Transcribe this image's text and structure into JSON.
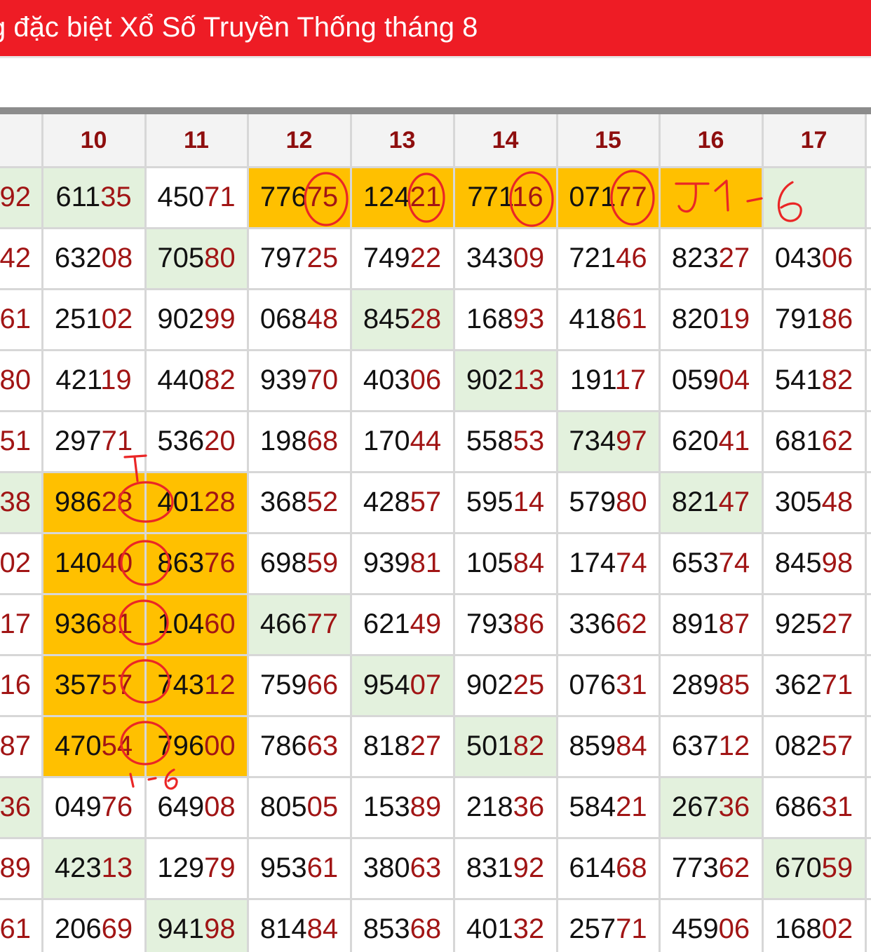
{
  "header": {
    "title": "g đặc biệt Xổ Số Truyền Thống tháng 8"
  },
  "colors": {
    "title_bg": "#ee1c25",
    "orange": "#ffc000",
    "green": "#e3f1dd",
    "tail_digits": "#a11515",
    "header_text": "#8e0e0e",
    "annotation": "#ea2626"
  },
  "table": {
    "columns": [
      "",
      "10",
      "11",
      "12",
      "13",
      "14",
      "15",
      "16",
      "17"
    ],
    "rows": [
      [
        "92",
        "61135",
        "45071",
        "77675",
        "12421",
        "77116",
        "07177",
        "",
        ""
      ],
      [
        "42",
        "63208",
        "70580",
        "79725",
        "74922",
        "34309",
        "72146",
        "82327",
        "04306"
      ],
      [
        "61",
        "25102",
        "90299",
        "06848",
        "84528",
        "16893",
        "41861",
        "82019",
        "79186"
      ],
      [
        "80",
        "42119",
        "44082",
        "93970",
        "40306",
        "90213",
        "19117",
        "05904",
        "54182"
      ],
      [
        "51",
        "29771",
        "53620",
        "19868",
        "17044",
        "55853",
        "73497",
        "62041",
        "68162"
      ],
      [
        "38",
        "98628",
        "40128",
        "36852",
        "42857",
        "59514",
        "57980",
        "82147",
        "30548"
      ],
      [
        "02",
        "14040",
        "86376",
        "69859",
        "93981",
        "10584",
        "17474",
        "65374",
        "84598"
      ],
      [
        "17",
        "93681",
        "10460",
        "46677",
        "62149",
        "79386",
        "33662",
        "89187",
        "92527"
      ],
      [
        "16",
        "35757",
        "74312",
        "75966",
        "95407",
        "90225",
        "07631",
        "28985",
        "36271"
      ],
      [
        "87",
        "47054",
        "79600",
        "78663",
        "81827",
        "50182",
        "85984",
        "63712",
        "08257"
      ],
      [
        "36",
        "04976",
        "64908",
        "80505",
        "15389",
        "21836",
        "58421",
        "26736",
        "68631"
      ],
      [
        "89",
        "42313",
        "12979",
        "95361",
        "38063",
        "83192",
        "61468",
        "77362",
        "67059"
      ],
      [
        "61",
        "20669",
        "94198",
        "81484",
        "85368",
        "40132",
        "25771",
        "45906",
        "16802"
      ]
    ],
    "highlights": [
      [
        "green",
        "green",
        "",
        "orange",
        "orange",
        "orange",
        "orange",
        "orange",
        "green"
      ],
      [
        "",
        "",
        "green",
        "",
        "",
        "",
        "",
        "",
        ""
      ],
      [
        "",
        "",
        "",
        "",
        "green",
        "",
        "",
        "",
        ""
      ],
      [
        "",
        "",
        "",
        "",
        "",
        "green",
        "",
        "",
        ""
      ],
      [
        "",
        "",
        "",
        "",
        "",
        "",
        "green",
        "",
        ""
      ],
      [
        "green",
        "orange",
        "orange",
        "",
        "",
        "",
        "",
        "green",
        ""
      ],
      [
        "",
        "orange",
        "orange",
        "",
        "",
        "",
        "",
        "",
        ""
      ],
      [
        "",
        "orange",
        "orange",
        "green",
        "",
        "",
        "",
        "",
        ""
      ],
      [
        "",
        "orange",
        "orange",
        "",
        "green",
        "",
        "",
        "",
        ""
      ],
      [
        "",
        "orange",
        "orange",
        "",
        "",
        "green",
        "",
        "",
        ""
      ],
      [
        "green",
        "",
        "",
        "",
        "",
        "",
        "",
        "green",
        ""
      ],
      [
        "",
        "green",
        "",
        "",
        "",
        "",
        "",
        "",
        "green"
      ],
      [
        "",
        "",
        "green",
        "",
        "",
        "",
        "",
        "",
        ""
      ]
    ]
  }
}
